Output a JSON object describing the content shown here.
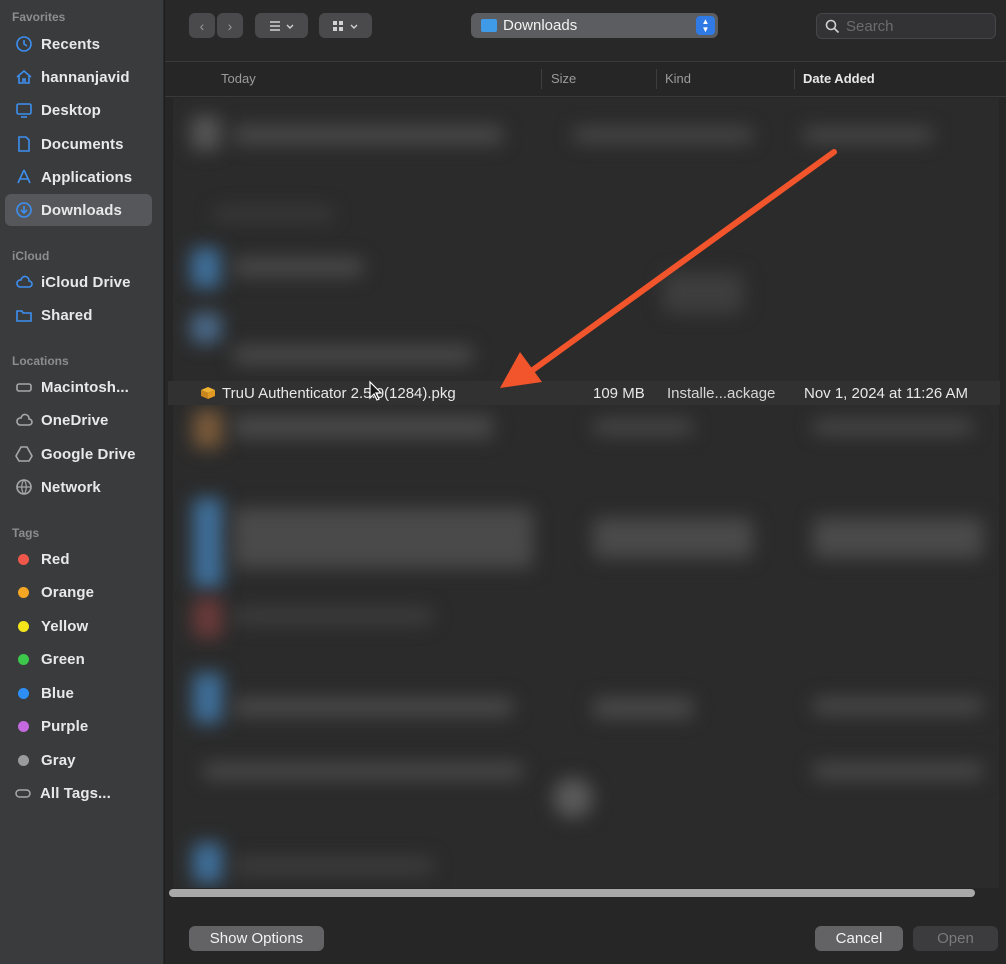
{
  "sidebar": {
    "favorites_title": "Favorites",
    "favorites": [
      {
        "label": "Recents",
        "icon": "clock-icon"
      },
      {
        "label": "hannanjavid",
        "icon": "home-icon"
      },
      {
        "label": "Desktop",
        "icon": "desktop-icon"
      },
      {
        "label": "Documents",
        "icon": "document-icon"
      },
      {
        "label": "Applications",
        "icon": "applications-icon"
      },
      {
        "label": "Downloads",
        "icon": "download-icon",
        "selected": true
      }
    ],
    "icloud_title": "iCloud",
    "icloud": [
      {
        "label": "iCloud Drive",
        "icon": "cloud-icon"
      },
      {
        "label": "Shared",
        "icon": "shared-folder-icon"
      }
    ],
    "locations_title": "Locations",
    "locations": [
      {
        "label": "Macintosh...",
        "icon": "disk-icon"
      },
      {
        "label": "OneDrive",
        "icon": "cloud-icon"
      },
      {
        "label": "Google Drive",
        "icon": "drive-icon"
      },
      {
        "label": "Network",
        "icon": "globe-icon"
      }
    ],
    "tags_title": "Tags",
    "tags": [
      {
        "label": "Red",
        "color": "#f0574b"
      },
      {
        "label": "Orange",
        "color": "#f5a623"
      },
      {
        "label": "Yellow",
        "color": "#f5e61c"
      },
      {
        "label": "Green",
        "color": "#3cc84a"
      },
      {
        "label": "Blue",
        "color": "#2d8ff5"
      },
      {
        "label": "Purple",
        "color": "#c569e0"
      },
      {
        "label": "Gray",
        "color": "#9b9b9b"
      },
      {
        "label": "All Tags...",
        "icon": "tag-icon"
      }
    ]
  },
  "toolbar": {
    "location": "Downloads",
    "search_placeholder": "Search"
  },
  "columns": {
    "name": "Today",
    "size": "Size",
    "kind": "Kind",
    "date": "Date Added"
  },
  "selected_file": {
    "name": "TruU Authenticator 2.5.0(1284).pkg",
    "size": "109 MB",
    "kind": "Installe...ackage",
    "date": "Nov 1, 2024 at 11:26 AM"
  },
  "footer": {
    "show_options": "Show Options",
    "cancel": "Cancel",
    "open": "Open"
  },
  "colors": {
    "annotation_arrow": "#f2542b",
    "accent": "#2f7ae5"
  }
}
